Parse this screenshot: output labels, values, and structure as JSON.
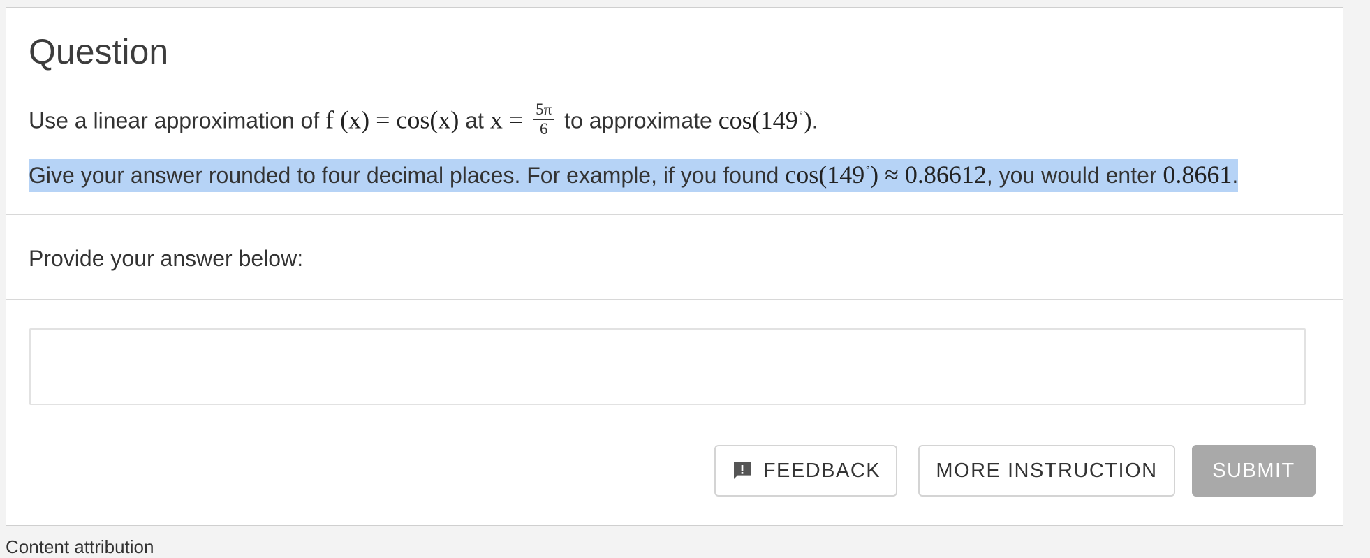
{
  "question": {
    "title": "Question",
    "line1": {
      "t1": "Use a linear approximation of ",
      "m1": "f (x) = cos(x)",
      "t2": " at ",
      "m2": "x = ",
      "frac_num": "5π",
      "frac_den": "6",
      "t3": " to approximate ",
      "m3": "cos(149",
      "deg": "∘",
      "m4": ")",
      "t4": "."
    },
    "line2": {
      "t1": "Give your answer rounded to four decimal places. For example, if you found ",
      "m1": "cos(149",
      "deg": "∘",
      "m2": ") ≈ 0.86612",
      "t2": ", you would enter ",
      "m3": "0.8661",
      "t3": "."
    }
  },
  "answer": {
    "prompt": "Provide your answer below:",
    "value": "",
    "placeholder": ""
  },
  "buttons": {
    "feedback": "FEEDBACK",
    "more_instruction": "MORE INSTRUCTION",
    "submit": "SUBMIT"
  },
  "footer": {
    "attribution": "Content attribution"
  },
  "colors": {
    "selection_highlight": "#b6d3f6",
    "submit_disabled": "#a9a9a9",
    "border": "#d4d4d4",
    "page_background": "#f3f3f3"
  },
  "icons": {
    "feedback": "feedback-comment-exclamation-icon"
  }
}
